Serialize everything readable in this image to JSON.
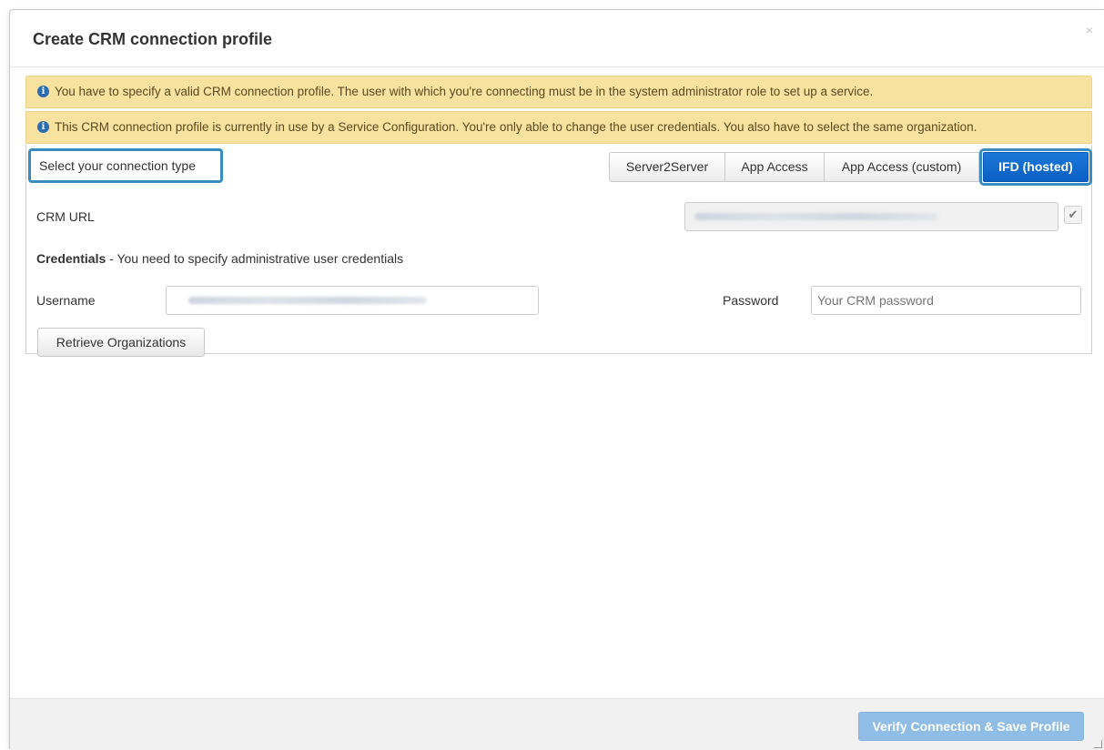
{
  "modal": {
    "title": "Create CRM connection profile",
    "close_symbol": "×"
  },
  "alerts": [
    {
      "icon": "info-icon",
      "text": "You have to specify a valid CRM connection profile. The user with which you're connecting must be in the system administrator role to set up a service."
    },
    {
      "icon": "info-icon",
      "text": "This CRM connection profile is currently in use by a Service Configuration. You're only able to change the user credentials. You also have to select the same organization."
    }
  ],
  "connection": {
    "label": "Select your connection type",
    "options": [
      "Server2Server",
      "App Access",
      "App Access (custom)",
      "IFD (hosted)"
    ],
    "selected": "IFD (hosted)"
  },
  "crm_url": {
    "label": "CRM URL",
    "value_blurred": true,
    "verified_icon": "checkmark-icon",
    "check_symbol": "✔"
  },
  "credentials": {
    "heading_bold": "Credentials",
    "heading_rest": " - You need to specify administrative user credentials",
    "username_label": "Username",
    "username_blurred": true,
    "password_label": "Password",
    "password_placeholder": "Your CRM password"
  },
  "retrieve_button": "Retrieve Organizations",
  "footer": {
    "save_button": "Verify Connection & Save Profile"
  },
  "colors": {
    "alert_bg": "#f7e2a0",
    "highlight_border": "#3a8bbf",
    "primary": "#0d6ad3",
    "primary_disabled": "#8fbde6"
  }
}
